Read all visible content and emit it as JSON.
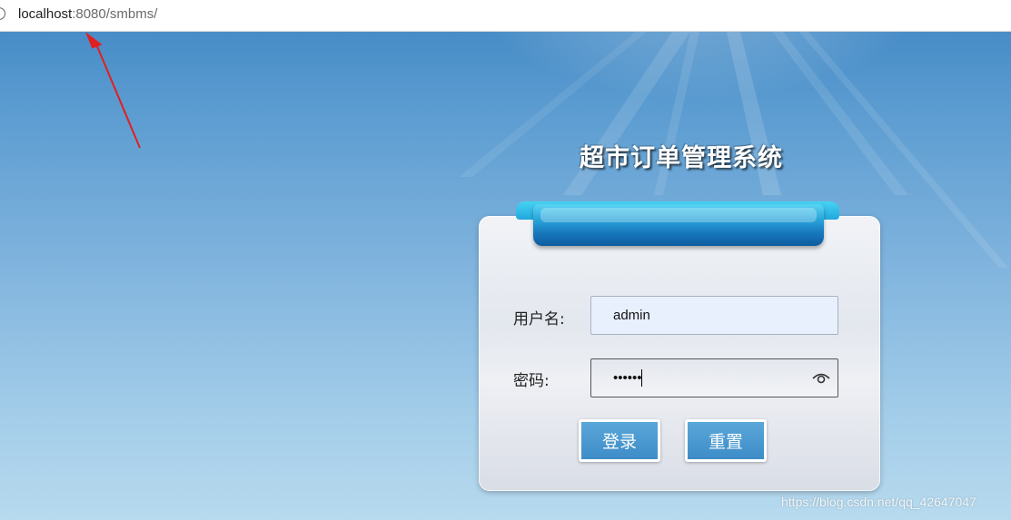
{
  "browser": {
    "url_host": "localhost",
    "url_rest": ":8080/smbms/"
  },
  "page": {
    "title": "超市订单管理系统"
  },
  "login_form": {
    "username_label": "用户名:",
    "username_value": "admin",
    "password_label": "密码:",
    "password_masked": "••••••",
    "login_button": "登录",
    "reset_button": "重置"
  },
  "watermark": "https://blog.csdn.net/qq_42647047",
  "colors": {
    "background_top": "#3f86c3",
    "background_bottom": "#b7daee",
    "button_blue": "#4a98cf",
    "ribbon_blue": "#1776bb",
    "annotation_arrow": "#e02020"
  },
  "icons": {
    "address_info": "info-icon",
    "password_reveal": "eye-icon",
    "annotation": "red-arrow"
  }
}
